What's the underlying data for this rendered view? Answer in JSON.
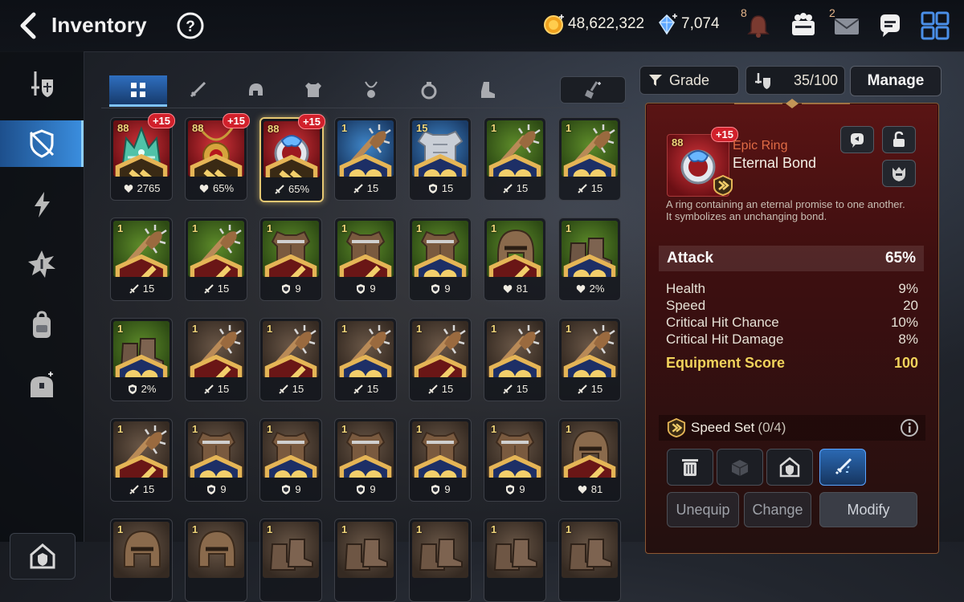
{
  "header": {
    "title": "Inventory",
    "gold": "48,622,322",
    "crystals": "7,074",
    "notifications_badge": "8",
    "mail_badge": "2"
  },
  "sidebar": {
    "items": [
      {
        "icon": "sword-shield-icon"
      },
      {
        "icon": "shield-slash-icon",
        "active": true
      },
      {
        "icon": "lightning-icon"
      },
      {
        "icon": "burst-icon"
      },
      {
        "icon": "backpack-icon"
      },
      {
        "icon": "chest-icon"
      }
    ],
    "bottom_icon": "guild-house-icon"
  },
  "category_tabs": [
    "all-grid-icon",
    "weapon-icon",
    "helmet-icon",
    "armor-icon",
    "necklace-icon",
    "ring-icon",
    "boots-icon"
  ],
  "controls": {
    "grade_label": "Grade",
    "capacity": "35/100",
    "manage_label": "Manage"
  },
  "grid": {
    "rows": [
      [
        {
          "level": "88",
          "plus": "+15",
          "bg": "red",
          "art": "crown",
          "set": "speed",
          "stat_icon": "heart-icon",
          "stat": "2765"
        },
        {
          "level": "88",
          "plus": "+15",
          "bg": "red",
          "art": "amulet",
          "set": "speed",
          "stat_icon": "heart-icon",
          "stat": "65%"
        },
        {
          "level": "88",
          "plus": "+15",
          "bg": "red",
          "art": "ring",
          "set": "speed",
          "stat_icon": "sword-icon",
          "stat": "65%",
          "selected": true
        },
        {
          "level": "1",
          "bg": "blue",
          "art": "club",
          "set": "health",
          "stat_icon": "sword-icon",
          "stat": "15"
        },
        {
          "level": "15",
          "bg": "blue",
          "art": "armor",
          "set": "health",
          "stat_icon": "shield-icon",
          "stat": "15"
        },
        {
          "level": "1",
          "bg": "green",
          "art": "club",
          "set": "health",
          "stat_icon": "sword-icon",
          "stat": "15"
        },
        {
          "level": "1",
          "bg": "green",
          "art": "club",
          "set": "health",
          "stat_icon": "sword-icon",
          "stat": "15"
        }
      ],
      [
        {
          "level": "1",
          "bg": "green",
          "art": "club",
          "set": "attack",
          "stat_icon": "sword-icon",
          "stat": "15"
        },
        {
          "level": "1",
          "bg": "green",
          "art": "club",
          "set": "attack",
          "stat_icon": "sword-icon",
          "stat": "15"
        },
        {
          "level": "1",
          "bg": "green",
          "art": "armor-brown",
          "set": "attack",
          "stat_icon": "shield-icon",
          "stat": "9"
        },
        {
          "level": "1",
          "bg": "green",
          "art": "armor-brown",
          "set": "attack",
          "stat_icon": "shield-icon",
          "stat": "9"
        },
        {
          "level": "1",
          "bg": "green",
          "art": "armor-brown",
          "set": "health",
          "stat_icon": "shield-icon",
          "stat": "9"
        },
        {
          "level": "1",
          "bg": "green",
          "art": "helmet",
          "set": "attack",
          "stat_icon": "heart-icon",
          "stat": "81"
        },
        {
          "level": "1",
          "bg": "green",
          "art": "boots",
          "set": "health",
          "stat_icon": "heart-icon",
          "stat": "2%"
        }
      ],
      [
        {
          "level": "1",
          "bg": "green",
          "art": "boots",
          "set": "health",
          "stat_icon": "shield-icon",
          "stat": "2%"
        },
        {
          "level": "1",
          "bg": "brown",
          "art": "club",
          "set": "attack",
          "stat_icon": "sword-icon",
          "stat": "15"
        },
        {
          "level": "1",
          "bg": "brown",
          "art": "club",
          "set": "attack",
          "stat_icon": "sword-icon",
          "stat": "15"
        },
        {
          "level": "1",
          "bg": "brown",
          "art": "club",
          "set": "health",
          "stat_icon": "sword-icon",
          "stat": "15"
        },
        {
          "level": "1",
          "bg": "brown",
          "art": "club",
          "set": "attack",
          "stat_icon": "sword-icon",
          "stat": "15"
        },
        {
          "level": "1",
          "bg": "brown",
          "art": "club",
          "set": "health",
          "stat_icon": "sword-icon",
          "stat": "15"
        },
        {
          "level": "1",
          "bg": "brown",
          "art": "club",
          "set": "health",
          "stat_icon": "sword-icon",
          "stat": "15"
        }
      ],
      [
        {
          "level": "1",
          "bg": "brown",
          "art": "club",
          "set": "attack",
          "stat_icon": "sword-icon",
          "stat": "15"
        },
        {
          "level": "1",
          "bg": "brown",
          "art": "armor-brown",
          "set": "health",
          "stat_icon": "shield-icon",
          "stat": "9"
        },
        {
          "level": "1",
          "bg": "brown",
          "art": "armor-brown",
          "set": "health",
          "stat_icon": "shield-icon",
          "stat": "9"
        },
        {
          "level": "1",
          "bg": "brown",
          "art": "armor-brown",
          "set": "health",
          "stat_icon": "shield-icon",
          "stat": "9"
        },
        {
          "level": "1",
          "bg": "brown",
          "art": "armor-brown",
          "set": "health",
          "stat_icon": "shield-icon",
          "stat": "9"
        },
        {
          "level": "1",
          "bg": "brown",
          "art": "armor-brown",
          "set": "health",
          "stat_icon": "shield-icon",
          "stat": "9"
        },
        {
          "level": "1",
          "bg": "brown",
          "art": "helmet",
          "set": "attack",
          "stat_icon": "heart-icon",
          "stat": "81"
        }
      ],
      [
        {
          "level": "1",
          "bg": "brown",
          "art": "helmet"
        },
        {
          "level": "1",
          "bg": "brown",
          "art": "helmet"
        },
        {
          "level": "1",
          "bg": "brown",
          "art": "boots"
        },
        {
          "level": "1",
          "bg": "brown",
          "art": "boots"
        },
        {
          "level": "1",
          "bg": "brown",
          "art": "boots"
        },
        {
          "level": "1",
          "bg": "brown",
          "art": "boots"
        },
        {
          "level": "1",
          "bg": "brown",
          "art": "boots"
        }
      ]
    ]
  },
  "detail": {
    "level": "88",
    "plus": "+15",
    "rarity": "Epic Ring",
    "name": "Eternal Bond",
    "description_line1": "A ring containing an eternal promise to one another.",
    "description_line2": "It symbolizes an unchanging bond.",
    "main_stat": {
      "label": "Attack",
      "value": "65%"
    },
    "sub_stats": [
      {
        "label": "Health",
        "value": "9%"
      },
      {
        "label": "Speed",
        "value": "20"
      },
      {
        "label": "Critical Hit Chance",
        "value": "10%"
      },
      {
        "label": "Critical Hit Damage",
        "value": "8%"
      }
    ],
    "score_label": "Equipment Score",
    "score_value": "100",
    "set_name": "Speed Set",
    "set_count": "(0/4)",
    "unequip_label": "Unequip",
    "change_label": "Change",
    "modify_label": "Modify"
  },
  "colors": {
    "accent_blue": "#3b8fe0",
    "epic_red": "#e06b45",
    "score_gold": "#f1d35b",
    "plus_badge": "#d1202b"
  }
}
